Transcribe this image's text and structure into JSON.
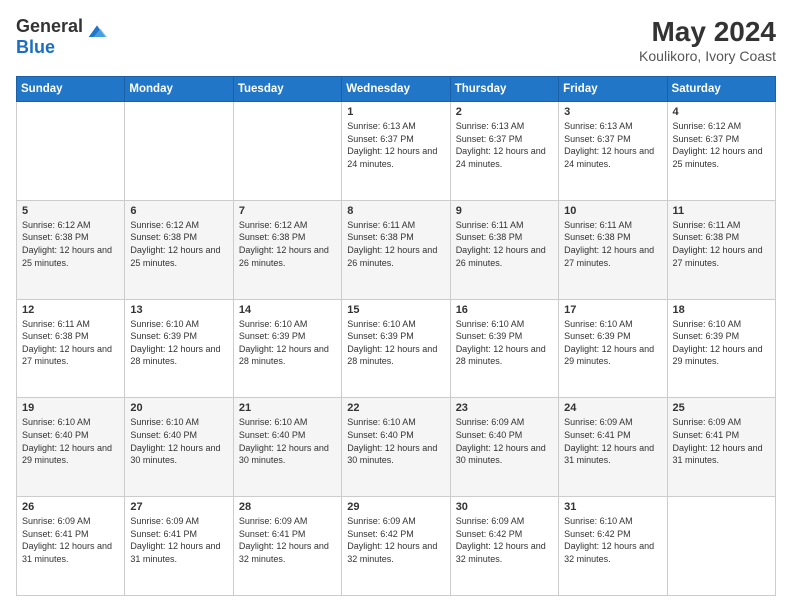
{
  "logo": {
    "general": "General",
    "blue": "Blue"
  },
  "header": {
    "title": "May 2024",
    "subtitle": "Koulikoro, Ivory Coast"
  },
  "weekdays": [
    "Sunday",
    "Monday",
    "Tuesday",
    "Wednesday",
    "Thursday",
    "Friday",
    "Saturday"
  ],
  "weeks": [
    [
      {
        "day": "",
        "info": ""
      },
      {
        "day": "",
        "info": ""
      },
      {
        "day": "",
        "info": ""
      },
      {
        "day": "1",
        "info": "Sunrise: 6:13 AM\nSunset: 6:37 PM\nDaylight: 12 hours and 24 minutes."
      },
      {
        "day": "2",
        "info": "Sunrise: 6:13 AM\nSunset: 6:37 PM\nDaylight: 12 hours and 24 minutes."
      },
      {
        "day": "3",
        "info": "Sunrise: 6:13 AM\nSunset: 6:37 PM\nDaylight: 12 hours and 24 minutes."
      },
      {
        "day": "4",
        "info": "Sunrise: 6:12 AM\nSunset: 6:37 PM\nDaylight: 12 hours and 25 minutes."
      }
    ],
    [
      {
        "day": "5",
        "info": "Sunrise: 6:12 AM\nSunset: 6:38 PM\nDaylight: 12 hours and 25 minutes."
      },
      {
        "day": "6",
        "info": "Sunrise: 6:12 AM\nSunset: 6:38 PM\nDaylight: 12 hours and 25 minutes."
      },
      {
        "day": "7",
        "info": "Sunrise: 6:12 AM\nSunset: 6:38 PM\nDaylight: 12 hours and 26 minutes."
      },
      {
        "day": "8",
        "info": "Sunrise: 6:11 AM\nSunset: 6:38 PM\nDaylight: 12 hours and 26 minutes."
      },
      {
        "day": "9",
        "info": "Sunrise: 6:11 AM\nSunset: 6:38 PM\nDaylight: 12 hours and 26 minutes."
      },
      {
        "day": "10",
        "info": "Sunrise: 6:11 AM\nSunset: 6:38 PM\nDaylight: 12 hours and 27 minutes."
      },
      {
        "day": "11",
        "info": "Sunrise: 6:11 AM\nSunset: 6:38 PM\nDaylight: 12 hours and 27 minutes."
      }
    ],
    [
      {
        "day": "12",
        "info": "Sunrise: 6:11 AM\nSunset: 6:38 PM\nDaylight: 12 hours and 27 minutes."
      },
      {
        "day": "13",
        "info": "Sunrise: 6:10 AM\nSunset: 6:39 PM\nDaylight: 12 hours and 28 minutes."
      },
      {
        "day": "14",
        "info": "Sunrise: 6:10 AM\nSunset: 6:39 PM\nDaylight: 12 hours and 28 minutes."
      },
      {
        "day": "15",
        "info": "Sunrise: 6:10 AM\nSunset: 6:39 PM\nDaylight: 12 hours and 28 minutes."
      },
      {
        "day": "16",
        "info": "Sunrise: 6:10 AM\nSunset: 6:39 PM\nDaylight: 12 hours and 28 minutes."
      },
      {
        "day": "17",
        "info": "Sunrise: 6:10 AM\nSunset: 6:39 PM\nDaylight: 12 hours and 29 minutes."
      },
      {
        "day": "18",
        "info": "Sunrise: 6:10 AM\nSunset: 6:39 PM\nDaylight: 12 hours and 29 minutes."
      }
    ],
    [
      {
        "day": "19",
        "info": "Sunrise: 6:10 AM\nSunset: 6:40 PM\nDaylight: 12 hours and 29 minutes."
      },
      {
        "day": "20",
        "info": "Sunrise: 6:10 AM\nSunset: 6:40 PM\nDaylight: 12 hours and 30 minutes."
      },
      {
        "day": "21",
        "info": "Sunrise: 6:10 AM\nSunset: 6:40 PM\nDaylight: 12 hours and 30 minutes."
      },
      {
        "day": "22",
        "info": "Sunrise: 6:10 AM\nSunset: 6:40 PM\nDaylight: 12 hours and 30 minutes."
      },
      {
        "day": "23",
        "info": "Sunrise: 6:09 AM\nSunset: 6:40 PM\nDaylight: 12 hours and 30 minutes."
      },
      {
        "day": "24",
        "info": "Sunrise: 6:09 AM\nSunset: 6:41 PM\nDaylight: 12 hours and 31 minutes."
      },
      {
        "day": "25",
        "info": "Sunrise: 6:09 AM\nSunset: 6:41 PM\nDaylight: 12 hours and 31 minutes."
      }
    ],
    [
      {
        "day": "26",
        "info": "Sunrise: 6:09 AM\nSunset: 6:41 PM\nDaylight: 12 hours and 31 minutes."
      },
      {
        "day": "27",
        "info": "Sunrise: 6:09 AM\nSunset: 6:41 PM\nDaylight: 12 hours and 31 minutes."
      },
      {
        "day": "28",
        "info": "Sunrise: 6:09 AM\nSunset: 6:41 PM\nDaylight: 12 hours and 32 minutes."
      },
      {
        "day": "29",
        "info": "Sunrise: 6:09 AM\nSunset: 6:42 PM\nDaylight: 12 hours and 32 minutes."
      },
      {
        "day": "30",
        "info": "Sunrise: 6:09 AM\nSunset: 6:42 PM\nDaylight: 12 hours and 32 minutes."
      },
      {
        "day": "31",
        "info": "Sunrise: 6:10 AM\nSunset: 6:42 PM\nDaylight: 12 hours and 32 minutes."
      },
      {
        "day": "",
        "info": ""
      }
    ]
  ]
}
